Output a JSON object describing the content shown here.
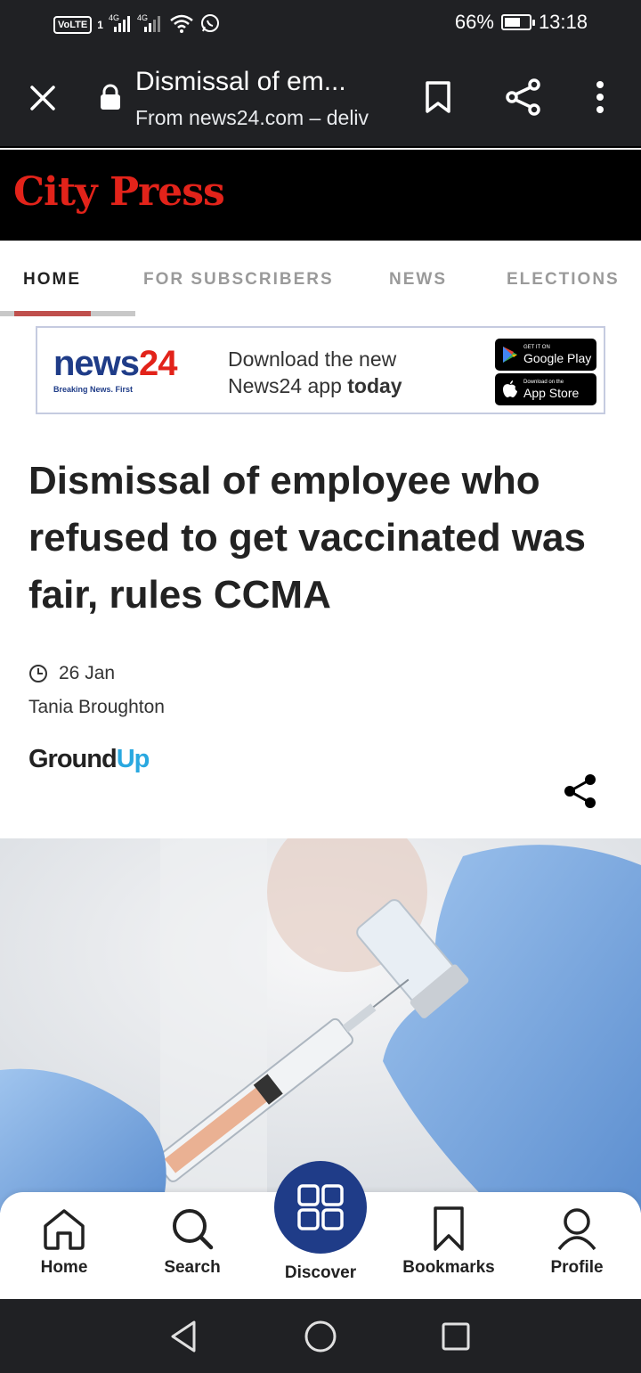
{
  "status_bar": {
    "volte": "VoLTE",
    "sim": "1",
    "net1": "4G",
    "net2": "4G",
    "battery_pct": "66%",
    "battery_level": 0.66,
    "time": "13:18"
  },
  "toolbar": {
    "title": "Dismissal of em...",
    "url": "From news24.com – deliv"
  },
  "masthead": {
    "logo": "City Press"
  },
  "nav": {
    "tabs": [
      {
        "label": "HOME",
        "active": true
      },
      {
        "label": "FOR SUBSCRIBERS",
        "active": false
      },
      {
        "label": "NEWS",
        "active": false
      },
      {
        "label": "ELECTIONS",
        "active": false
      }
    ]
  },
  "ad": {
    "logo_word": "news",
    "logo_num": "24",
    "tagline": "Breaking News. First",
    "line1": "Download the new",
    "line2_pre": "News24 app ",
    "line2_bold": "today",
    "google_small": "GET IT ON",
    "google_big": "Google Play",
    "apple_small": "Download on the",
    "apple_big": "App Store"
  },
  "article": {
    "headline": "Dismissal of employee who refused to get vaccinated was fair, rules CCMA",
    "date": "26 Jan",
    "author": "Tania Broughton",
    "source_left": "Ground",
    "source_right": "Up"
  },
  "bottom_nav": {
    "home": "Home",
    "search": "Search",
    "discover": "Discover",
    "bookmarks": "Bookmarks",
    "profile": "Profile"
  },
  "colors": {
    "brand_red": "#e2231a",
    "news24_blue": "#1f3c88",
    "groundup_blue": "#29a8e0",
    "toolbar_bg": "#202124"
  }
}
